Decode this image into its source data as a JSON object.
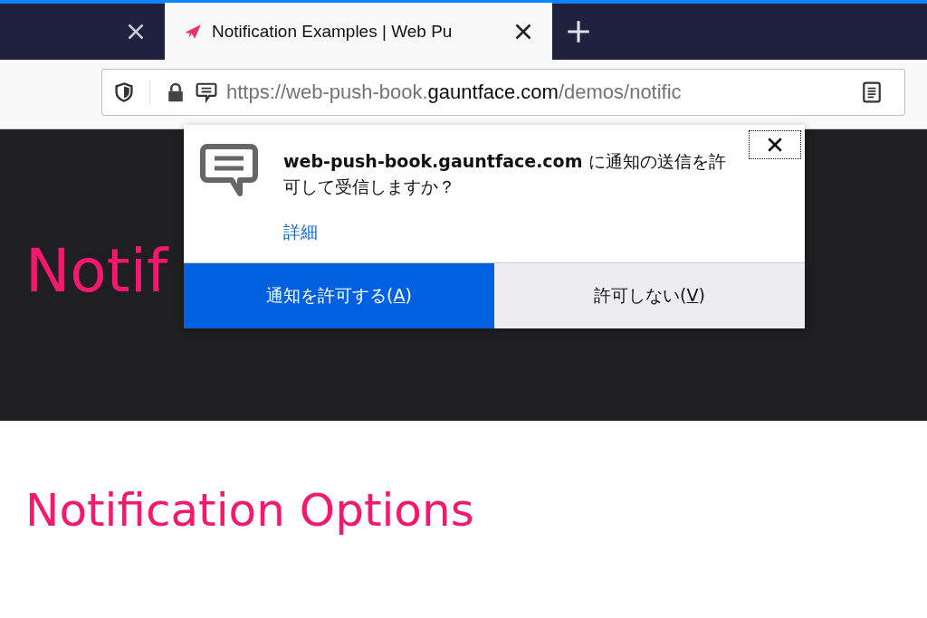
{
  "tabs": [
    {
      "selected": false
    },
    {
      "title": "Notification Examples | Web Pu",
      "selected": true
    }
  ],
  "address_bar": {
    "url_start": "https://web-push-book.",
    "url_host": "gauntface.com",
    "url_end": "/demos/notific"
  },
  "page": {
    "banner_heading": "Notif",
    "section_heading": "Notification Options"
  },
  "permission_popup": {
    "message": "**web-push-book.gauntface.com** に通知の送信を許可して受信しますか？",
    "details_link": "詳細",
    "buttons": [
      {
        "kind": "primary",
        "before": "通知を許可する(",
        "access_key": "A",
        "after": ")"
      },
      {
        "kind": "secondary",
        "before": "許可しない(",
        "access_key": "V",
        "after": ")"
      }
    ]
  }
}
